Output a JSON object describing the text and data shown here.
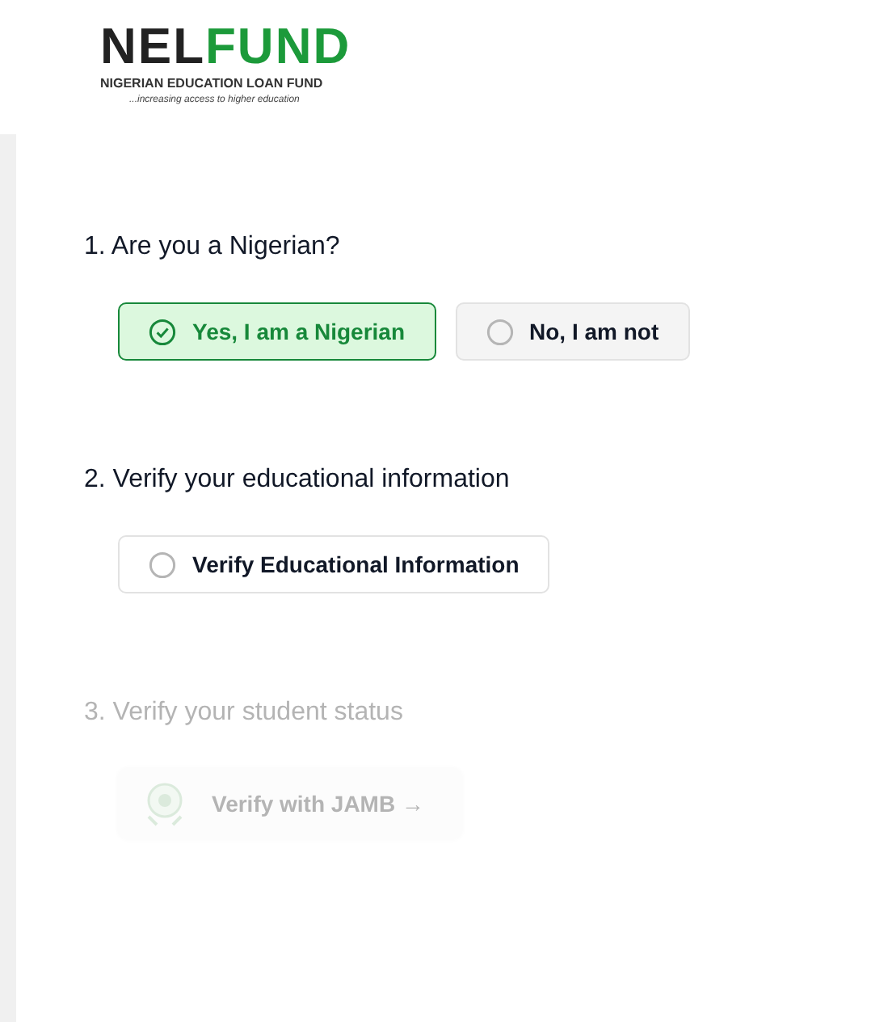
{
  "logo": {
    "mark_dark": "NEL",
    "mark_green": "FUND",
    "name": "NIGERIAN EDUCATION LOAN FUND",
    "tagline": "...increasing access to higher education"
  },
  "steps": [
    {
      "title": "1. Are you a Nigerian?",
      "disabled": false,
      "options": [
        {
          "kind": "radio",
          "label": "Yes, I am a Nigerian",
          "selected": true
        },
        {
          "kind": "radio",
          "label": "No, I am not",
          "selected": false
        }
      ]
    },
    {
      "title": "2. Verify your educational information",
      "disabled": false,
      "options": [
        {
          "kind": "radio",
          "label": "Verify Educational Information",
          "selected": false
        }
      ]
    },
    {
      "title": "3. Verify your student status",
      "disabled": true,
      "options": [
        {
          "kind": "seal",
          "label": "Verify with JAMB →"
        }
      ]
    }
  ]
}
